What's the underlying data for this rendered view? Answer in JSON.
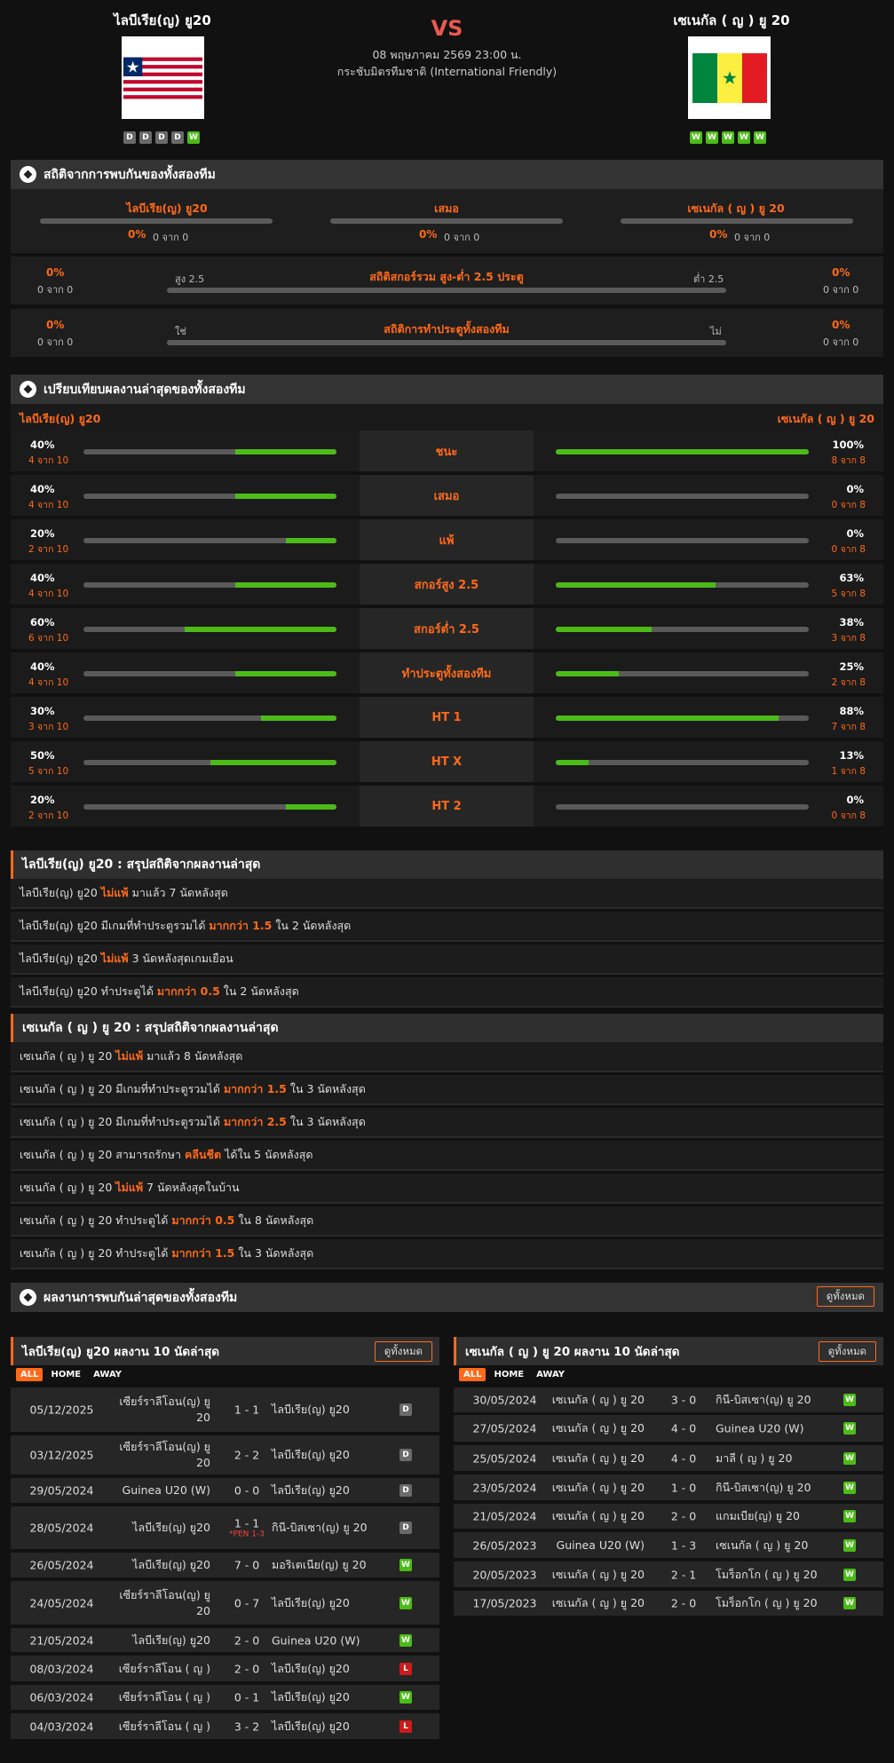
{
  "header": {
    "home_team": "ไลบีเรีย(ญ) ยู20",
    "away_team": "เซเนกัล ( ญ ) ยู 20",
    "vs": "VS",
    "datetime": "08 พฤษภาคม 2569 23:00 น.",
    "competition": "กระชับมิตรทีมชาติ (International Friendly)",
    "home_form": [
      "D",
      "D",
      "D",
      "D",
      "W"
    ],
    "away_form": [
      "W",
      "W",
      "W",
      "W",
      "W"
    ]
  },
  "h2h_stats": {
    "title": "สถิติจากการพบกันของทั้งสองทีม",
    "home_label": "ไลบีเรีย(ญ) ยู20",
    "draw_label": "เสมอ",
    "away_label": "เซเนกัล ( ญ ) ยู 20",
    "home_pct": "0%",
    "home_of": "0 จาก 0",
    "draw_pct": "0%",
    "draw_of": "0 จาก 0",
    "away_pct": "0%",
    "away_of": "0 จาก 0",
    "ou": {
      "title": "สถิติสกอร์รวม สูง-ต่ำ 2.5 ประตู",
      "over": "สูง 2.5",
      "under": "ต่ำ 2.5",
      "lpct": "0%",
      "lof": "0 จาก 0",
      "rpct": "0%",
      "rof": "0 จาก 0"
    },
    "btts": {
      "title": "สถิติการทำประตูทั้งสองทีม",
      "yes": "ใช่",
      "no": "ไม่",
      "lpct": "0%",
      "lof": "0 จาก 0",
      "rpct": "0%",
      "rof": "0 จาก 0"
    }
  },
  "compare": {
    "title": "เปรียบเทียบผลงานล่าสุดของทั้งสองทีม",
    "home": "ไลบีเรีย(ญ) ยู20",
    "away": "เซเนกัล ( ญ ) ยู 20",
    "rows": [
      {
        "label": "ชนะ",
        "lp": "40%",
        "lf": "4 จาก 10",
        "lv": 0.4,
        "rp": "100%",
        "rf": "8 จาก 8",
        "rv": 1.0
      },
      {
        "label": "เสมอ",
        "lp": "40%",
        "lf": "4 จาก 10",
        "lv": 0.4,
        "rp": "0%",
        "rf": "0 จาก 8",
        "rv": 0
      },
      {
        "label": "แพ้",
        "lp": "20%",
        "lf": "2 จาก 10",
        "lv": 0.2,
        "rp": "0%",
        "rf": "0 จาก 8",
        "rv": 0
      },
      {
        "label": "สกอร์สูง 2.5",
        "lp": "40%",
        "lf": "4 จาก 10",
        "lv": 0.4,
        "rp": "63%",
        "rf": "5 จาก 8",
        "rv": 0.63
      },
      {
        "label": "สกอร์ต่ำ 2.5",
        "lp": "60%",
        "lf": "6 จาก 10",
        "lv": 0.6,
        "rp": "38%",
        "rf": "3 จาก 8",
        "rv": 0.38
      },
      {
        "label": "ทำประตูทั้งสองทีม",
        "lp": "40%",
        "lf": "4 จาก 10",
        "lv": 0.4,
        "rp": "25%",
        "rf": "2 จาก 8",
        "rv": 0.25
      },
      {
        "label": "HT 1",
        "lp": "30%",
        "lf": "3 จาก 10",
        "lv": 0.3,
        "rp": "88%",
        "rf": "7 จาก 8",
        "rv": 0.88
      },
      {
        "label": "HT X",
        "lp": "50%",
        "lf": "5 จาก 10",
        "lv": 0.5,
        "rp": "13%",
        "rf": "1 จาก 8",
        "rv": 0.13
      },
      {
        "label": "HT 2",
        "lp": "20%",
        "lf": "2 จาก 10",
        "lv": 0.2,
        "rp": "0%",
        "rf": "0 จาก 8",
        "rv": 0
      }
    ]
  },
  "home_summary": {
    "title": "ไลบีเรีย(ญ) ยู20 : สรุปสถิติจากผลงานล่าสุด",
    "rows": [
      [
        "ไลบีเรีย(ญ) ยู20 ",
        "ไม่แพ้",
        " มาแล้ว 7 นัดหลังสุด"
      ],
      [
        "ไลบีเรีย(ญ) ยู20 มีเกมที่ทำประตูรวมได้ ",
        "มากกว่า 1.5",
        " ใน 2 นัดหลังสุด"
      ],
      [
        "ไลบีเรีย(ญ) ยู20 ",
        "ไม่แพ้",
        " 3 นัดหลังสุดเกมเยือน"
      ],
      [
        "ไลบีเรีย(ญ) ยู20 ทำประตูได้ ",
        "มากกว่า 0.5",
        " ใน 2 นัดหลังสุด"
      ]
    ]
  },
  "away_summary": {
    "title": "เซเนกัล ( ญ ) ยู 20 : สรุปสถิติจากผลงานล่าสุด",
    "rows": [
      [
        "เซเนกัล ( ญ ) ยู 20 ",
        "ไม่แพ้",
        " มาแล้ว 8 นัดหลังสุด"
      ],
      [
        "เซเนกัล ( ญ ) ยู 20 มีเกมที่ทำประตูรวมได้ ",
        "มากกว่า 1.5",
        " ใน 3 นัดหลังสุด"
      ],
      [
        "เซเนกัล ( ญ ) ยู 20 มีเกมที่ทำประตูรวมได้ ",
        "มากกว่า 2.5",
        " ใน 3 นัดหลังสุด"
      ],
      [
        "เซเนกัล ( ญ ) ยู 20 สามารถรักษา ",
        "คลีนชีต",
        " ได้ใน 5 นัดหลังสุด"
      ],
      [
        "เซเนกัล ( ญ ) ยู 20 ",
        "ไม่แพ้",
        " 7 นัดหลังสุดในบ้าน"
      ],
      [
        "เซเนกัล ( ญ ) ยู 20 ทำประตูได้ ",
        "มากกว่า 0.5",
        " ใน 8 นัดหลังสุด"
      ],
      [
        "เซเนกัล ( ญ ) ยู 20 ทำประตูได้ ",
        "มากกว่า 1.5",
        " ใน 3 นัดหลังสุด"
      ]
    ]
  },
  "h2h_results": {
    "title": "ผลงานการพบกันล่าสุดของทั้งสองทีม",
    "see_all": "ดูทั้งหมด"
  },
  "home_results": {
    "title": "ไลบีเรีย(ญ) ยู20 ผลงาน 10 นัดล่าสุด",
    "see_all": "ดูทั้งหมด",
    "tabs": [
      "ALL",
      "HOME",
      "AWAY"
    ],
    "matches": [
      {
        "date": "05/12/2025",
        "home": "เซียร์ราลีโอน(ญ) ยู 20",
        "score": "1 - 1",
        "away": "ไลบีเรีย(ญ) ยู20",
        "res": "D",
        "pen": ""
      },
      {
        "date": "03/12/2025",
        "home": "เซียร์ราลีโอน(ญ) ยู 20",
        "score": "2 - 2",
        "away": "ไลบีเรีย(ญ) ยู20",
        "res": "D",
        "pen": ""
      },
      {
        "date": "29/05/2024",
        "home": "Guinea U20 (W)",
        "score": "0 - 0",
        "away": "ไลบีเรีย(ญ) ยู20",
        "res": "D",
        "pen": ""
      },
      {
        "date": "28/05/2024",
        "home": "ไลบีเรีย(ญ) ยู20",
        "score": "1 - 1",
        "away": "กินี-บิสเซา(ญ) ยู 20",
        "res": "D",
        "pen": "*PEN 1-3"
      },
      {
        "date": "26/05/2024",
        "home": "ไลบีเรีย(ญ) ยู20",
        "score": "7 - 0",
        "away": "มอริเตเนีย(ญ) ยู 20",
        "res": "W",
        "pen": ""
      },
      {
        "date": "24/05/2024",
        "home": "เซียร์ราลีโอน(ญ) ยู 20",
        "score": "0 - 7",
        "away": "ไลบีเรีย(ญ) ยู20",
        "res": "W",
        "pen": ""
      },
      {
        "date": "21/05/2024",
        "home": "ไลบีเรีย(ญ) ยู20",
        "score": "2 - 0",
        "away": "Guinea U20 (W)",
        "res": "W",
        "pen": ""
      },
      {
        "date": "08/03/2024",
        "home": "เซียร์ราลีโอน ( ญ )",
        "score": "2 - 0",
        "away": "ไลบีเรีย(ญ) ยู20",
        "res": "L",
        "pen": ""
      },
      {
        "date": "06/03/2024",
        "home": "เซียร์ราลีโอน ( ญ )",
        "score": "0 - 1",
        "away": "ไลบีเรีย(ญ) ยู20",
        "res": "W",
        "pen": ""
      },
      {
        "date": "04/03/2024",
        "home": "เซียร์ราลีโอน ( ญ )",
        "score": "3 - 2",
        "away": "ไลบีเรีย(ญ) ยู20",
        "res": "L",
        "pen": ""
      }
    ]
  },
  "away_results": {
    "title": "เซเนกัล ( ญ ) ยู 20 ผลงาน 10 นัดล่าสุด",
    "see_all": "ดูทั้งหมด",
    "tabs": [
      "ALL",
      "HOME",
      "AWAY"
    ],
    "matches": [
      {
        "date": "30/05/2024",
        "home": "เซเนกัล ( ญ ) ยู 20",
        "score": "3 - 0",
        "away": "กินี-บิสเซา(ญ) ยู 20",
        "res": "W"
      },
      {
        "date": "27/05/2024",
        "home": "เซเนกัล ( ญ ) ยู 20",
        "score": "4 - 0",
        "away": "Guinea U20 (W)",
        "res": "W"
      },
      {
        "date": "25/05/2024",
        "home": "เซเนกัล ( ญ ) ยู 20",
        "score": "4 - 0",
        "away": "มาลี ( ญ ) ยู 20",
        "res": "W"
      },
      {
        "date": "23/05/2024",
        "home": "เซเนกัล ( ญ ) ยู 20",
        "score": "1 - 0",
        "away": "กินี-บิสเซา(ญ) ยู 20",
        "res": "W"
      },
      {
        "date": "21/05/2024",
        "home": "เซเนกัล ( ญ ) ยู 20",
        "score": "2 - 0",
        "away": "แกมเบีย(ญ) ยู 20",
        "res": "W"
      },
      {
        "date": "26/05/2023",
        "home": "Guinea U20 (W)",
        "score": "1 - 3",
        "away": "เซเนกัล ( ญ ) ยู 20",
        "res": "W"
      },
      {
        "date": "20/05/2023",
        "home": "เซเนกัล ( ญ ) ยู 20",
        "score": "2 - 1",
        "away": "โมร็อกโก ( ญ ) ยู 20",
        "res": "W"
      },
      {
        "date": "17/05/2023",
        "home": "เซเนกัล ( ญ ) ยู 20",
        "score": "2 - 0",
        "away": "โมร็อกโก ( ญ ) ยู 20",
        "res": "W"
      }
    ]
  },
  "colors": {
    "accent": "#ff6a1a",
    "bar_green": "#4cbb17",
    "bar_bg": "#5a5a5a",
    "win": "#4cbb17",
    "draw": "#6a6a6a",
    "loss": "#cc1b1b"
  }
}
